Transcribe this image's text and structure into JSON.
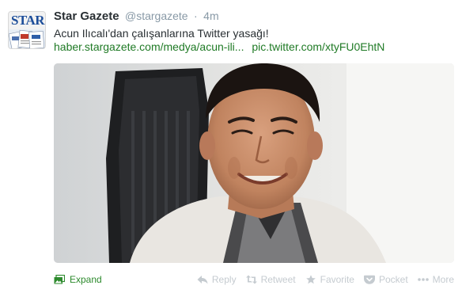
{
  "tweet": {
    "avatar_text": "STAR",
    "name": "Star Gazete",
    "handle": "@stargazete",
    "separator": "·",
    "time": "4m",
    "text": "Acun Ilıcalı'dan çalışanlarına Twitter yasağı!",
    "link_1": "haber.stargazete.com/medya/acun-ili...",
    "link_2": "pic.twitter.com/xtyFU0EhtN"
  },
  "actions": {
    "expand": "Expand",
    "reply": "Reply",
    "retweet": "Retweet",
    "favorite": "Favorite",
    "pocket": "Pocket",
    "more": "More"
  },
  "colors": {
    "link": "#1f7a25",
    "expand": "#2d8a2d",
    "action_inactive": "#c5cbd0",
    "name": "#292f33",
    "meta": "#8899a6"
  },
  "icons": {
    "expand": "photo-icon",
    "reply": "reply-icon",
    "retweet": "retweet-icon",
    "favorite": "star-icon",
    "pocket": "pocket-icon",
    "more": "ellipsis-icon"
  }
}
